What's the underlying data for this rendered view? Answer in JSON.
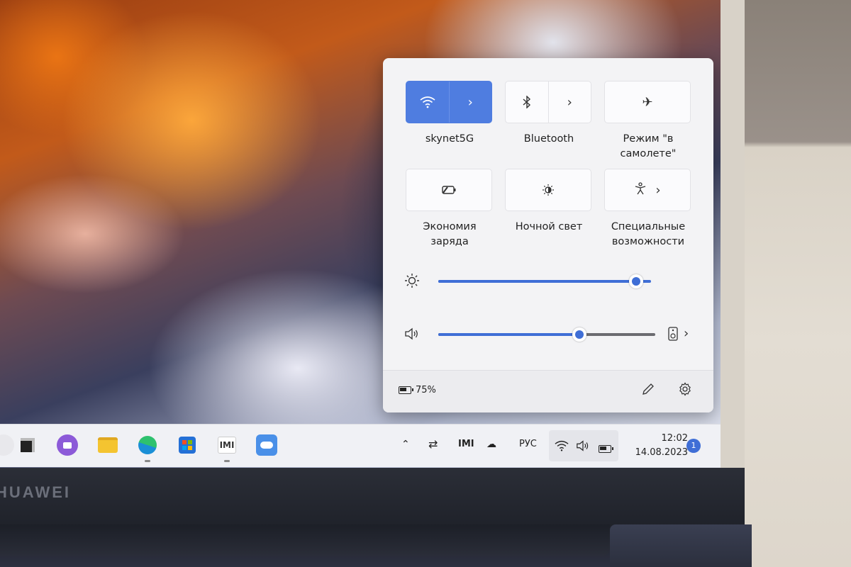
{
  "quick_settings": {
    "tiles": [
      {
        "label": "skynet5G",
        "icon": "wifi-icon",
        "active": true
      },
      {
        "label": "Bluetooth",
        "icon": "bluetooth-icon",
        "active": false
      },
      {
        "label": "Режим \"в самолете\"",
        "icon": "airplane-icon",
        "active": false
      },
      {
        "label": "Экономия заряда",
        "icon": "battery-saver-icon",
        "active": false
      },
      {
        "label": "Ночной свет",
        "icon": "night-light-icon",
        "active": false
      },
      {
        "label": "Специальные возможности",
        "icon": "accessibility-icon",
        "active": false
      }
    ],
    "brightness_level": 0.93,
    "volume_level": 0.65,
    "battery_text": "75%",
    "accent_color": "#3f6ed6"
  },
  "taskbar": {
    "apps": [
      "app-dark-icon",
      "chat-icon",
      "file-explorer-icon",
      "edge-icon",
      "store-icon",
      "pc-manager-icon",
      "cloud-icon"
    ],
    "language": "РУС",
    "time": "12:02",
    "date": "14.08.2023",
    "notifications": "1"
  },
  "brand": "HUAWEI"
}
